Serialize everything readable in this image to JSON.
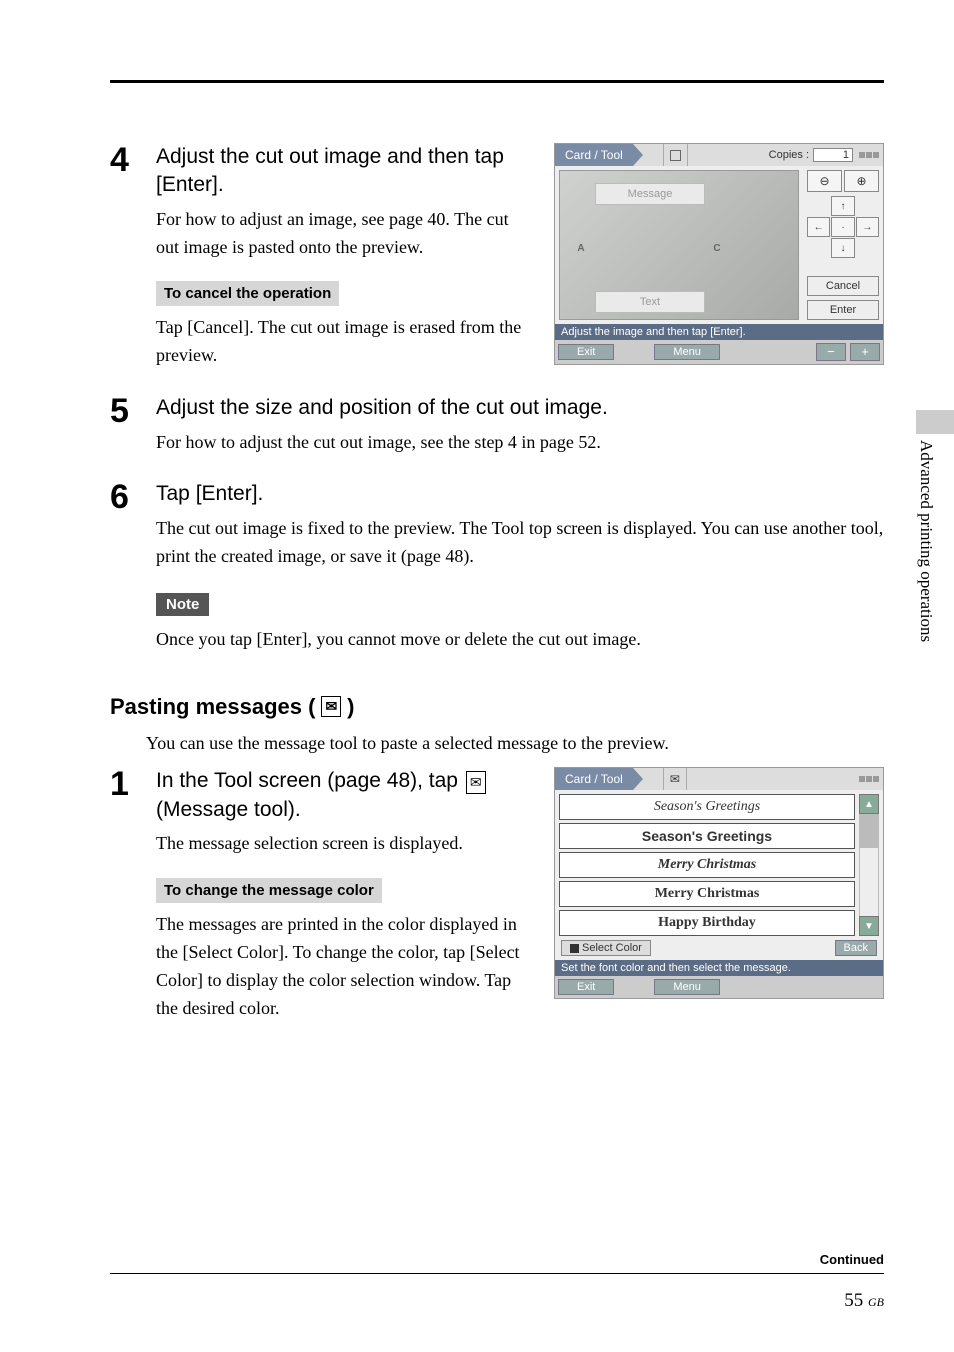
{
  "sideTab": "Advanced printing operations",
  "step4": {
    "num": "4",
    "title": "Adjust the cut out image and then tap [Enter].",
    "body": "For how to adjust an image, see page 40.  The cut out image is pasted onto the preview.",
    "cancelHeading": "To cancel the operation",
    "cancelBody": "Tap [Cancel].  The cut out image is erased from the preview."
  },
  "step5": {
    "num": "5",
    "title": "Adjust the size and position of the cut out image.",
    "body": "For how to adjust the cut out image, see the step 4 in page 52."
  },
  "step6": {
    "num": "6",
    "title": "Tap [Enter].",
    "body": "The cut out image is fixed to the preview.  The Tool top screen is displayed.  You can use another tool, print the created image, or save it (page 48).",
    "noteLabel": "Note",
    "noteBody": "Once you tap [Enter], you cannot move or delete the cut out image."
  },
  "pasting": {
    "heading": "Pasting messages (",
    "headingEnd": ")",
    "intro": "You can use the message tool to paste a selected message to the preview."
  },
  "step1b": {
    "num": "1",
    "titleA": "In the Tool screen (page 48), tap ",
    "titleB": " (Message tool).",
    "body": "The message selection screen is displayed.",
    "changeHeading": "To change the message color",
    "changeBody": "The messages are printed in the color displayed in the [Select Color].  To change the color, tap [Select Color] to display the color selection window.  Tap the desired color."
  },
  "ss1": {
    "tab": "Card / Tool",
    "copiesLabel": "Copies :",
    "copiesValue": "1",
    "message": "Message",
    "a": "A",
    "c": "C",
    "text": "Text",
    "cancel": "Cancel",
    "enter": "Enter",
    "status": "Adjust the image and then tap [Enter].",
    "exit": "Exit",
    "menu": "Menu",
    "minus": "−",
    "plus": "+"
  },
  "ss2": {
    "tab": "Card / Tool",
    "rows": [
      "Season's Greetings",
      "Season's Greetings",
      "Merry Christmas",
      "Merry Christmas",
      "Happy Birthday"
    ],
    "selectColor": "Select Color",
    "back": "Back",
    "status": "Set the font color and then select the message.",
    "exit": "Exit",
    "menu": "Menu"
  },
  "footer": {
    "continued": "Continued",
    "page": "55",
    "gb": "GB"
  }
}
